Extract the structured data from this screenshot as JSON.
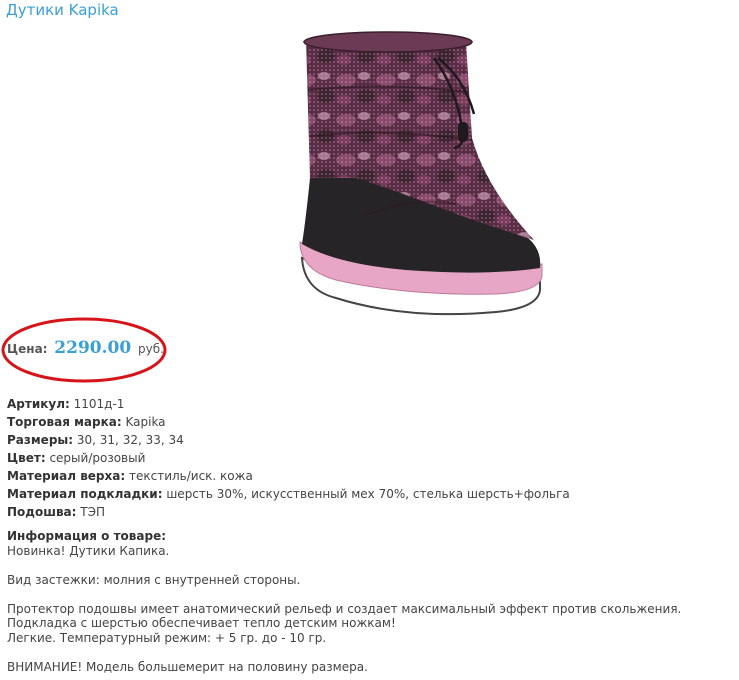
{
  "product": {
    "title": "Дутики Kapika"
  },
  "price": {
    "label": "Цена:",
    "value": "2290.00",
    "currency": "руб."
  },
  "specs": [
    {
      "label": "Артикул:",
      "value": "1101д-1"
    },
    {
      "label": "Торговая марка:",
      "value": "Kapika"
    },
    {
      "label": "Размеры:",
      "value": "30, 31, 32, 33, 34"
    },
    {
      "label": "Цвет:",
      "value": "серый/розовый"
    },
    {
      "label": "Материал верха:",
      "value": "текстиль/иск. кожа"
    },
    {
      "label": "Материал подкладки:",
      "value": "шерсть 30%, искусственный мех 70%, стелька шерсть+фольга"
    },
    {
      "label": "Подошва:",
      "value": "ТЭП"
    }
  ],
  "info": {
    "heading": "Информация о товаре:",
    "line1": "Новинка! Дутики Капика.",
    "line2": "Вид застежки: молния с внутренней стороны.",
    "line3": "Протектор подошвы имеет анатомический рельеф и создает максимальный эффект против скольжения.",
    "line4": "Подкладка с шерстью обеспечивает тепло детским ножкам!",
    "line5": "Легкие. Температурный режим: + 5 гр. до - 10 гр.",
    "line6": "ВНИМАНИЕ! Модель большемерит на половину размера."
  },
  "colors": {
    "link": "#3a9fd6",
    "highlight_circle": "#d6141a",
    "boot_body": "#5a2c46",
    "boot_sole_pink": "#e8a6c6"
  }
}
